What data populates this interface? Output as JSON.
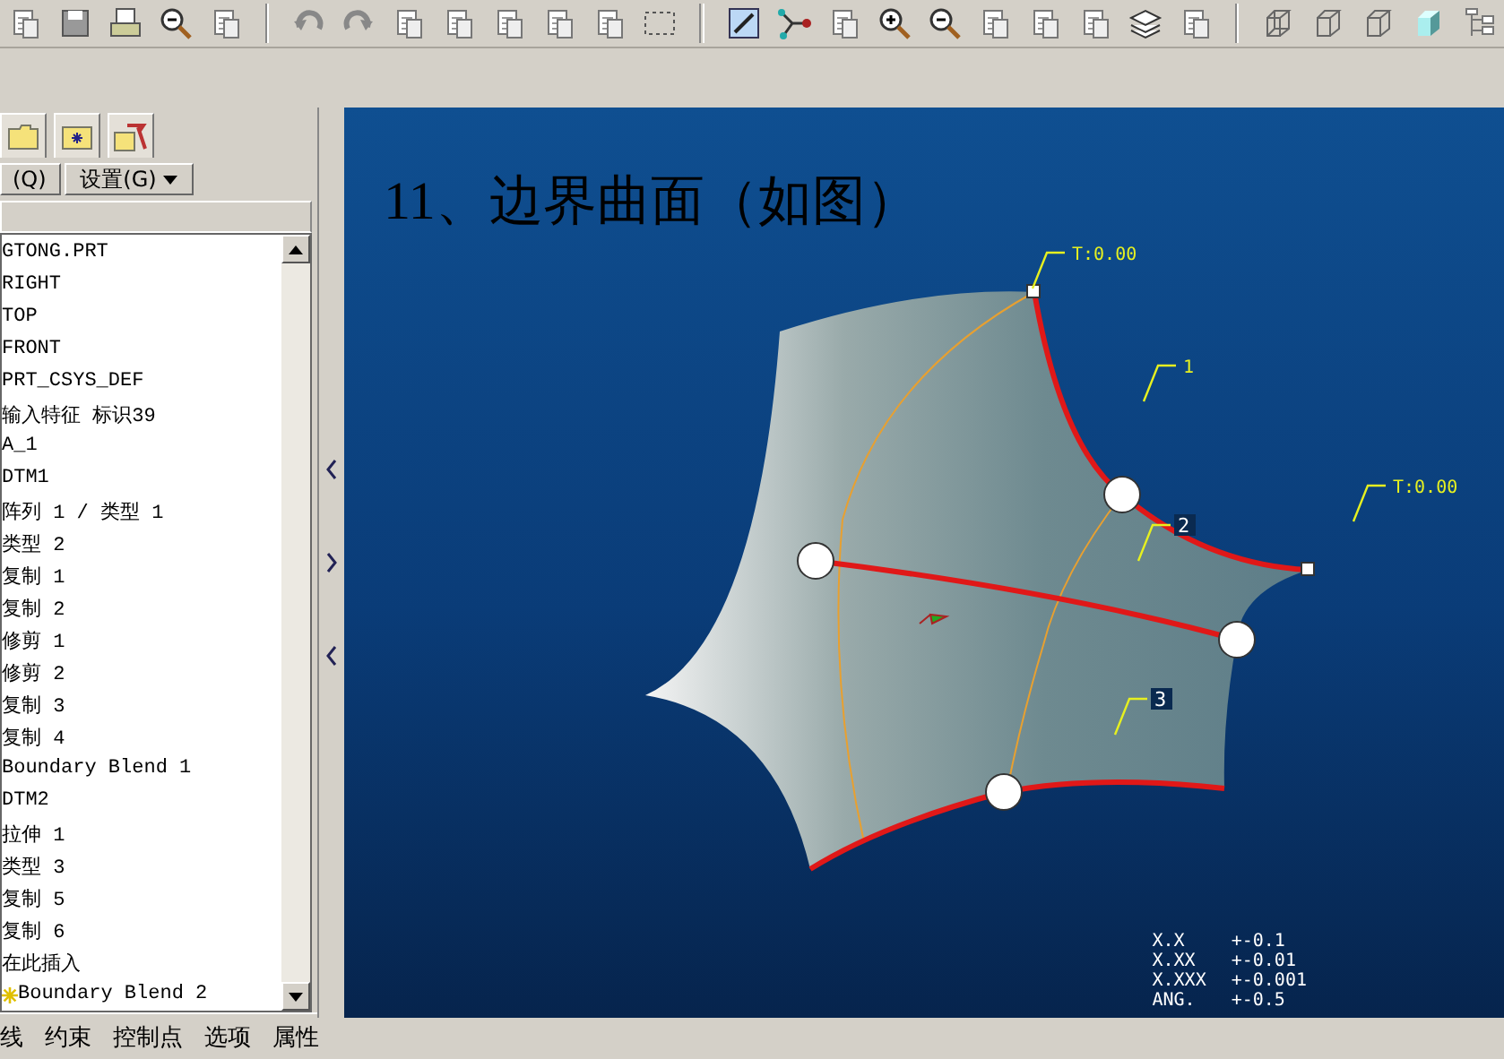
{
  "panel": {
    "buttons": [
      {
        "label": "(Q)"
      },
      {
        "label": "设置(G)"
      }
    ],
    "tree": [
      {
        "label": "GTONG.PRT",
        "kind": "item"
      },
      {
        "label": "RIGHT",
        "kind": "item"
      },
      {
        "label": "TOP",
        "kind": "item"
      },
      {
        "label": "FRONT",
        "kind": "item"
      },
      {
        "label": "PRT_CSYS_DEF",
        "kind": "item"
      },
      {
        "label": "输入特征 标识39",
        "kind": "item"
      },
      {
        "label": "A_1",
        "kind": "item"
      },
      {
        "label": "DTM1",
        "kind": "item"
      },
      {
        "label": "阵列 1 / 类型 1",
        "kind": "item"
      },
      {
        "label": "类型 2",
        "kind": "item"
      },
      {
        "label": "复制 1",
        "kind": "item"
      },
      {
        "label": "复制 2",
        "kind": "item"
      },
      {
        "label": "修剪 1",
        "kind": "item"
      },
      {
        "label": "修剪 2",
        "kind": "item"
      },
      {
        "label": "复制 3",
        "kind": "item"
      },
      {
        "label": "复制 4",
        "kind": "item"
      },
      {
        "label": "Boundary Blend 1",
        "kind": "item"
      },
      {
        "label": "DTM2",
        "kind": "item"
      },
      {
        "label": "拉伸 1",
        "kind": "item"
      },
      {
        "label": "类型 3",
        "kind": "item"
      },
      {
        "label": "复制 5",
        "kind": "item"
      },
      {
        "label": "复制 6",
        "kind": "item"
      },
      {
        "label": "在此插入",
        "kind": "item"
      },
      {
        "label": "Boundary Blend 2",
        "kind": "new"
      }
    ]
  },
  "viewport": {
    "title": "11、边界曲面（如图）",
    "callouts": [
      {
        "label": "T:0.00",
        "kind": "plain"
      },
      {
        "label": "1",
        "kind": "plain"
      },
      {
        "label": "T:0.00",
        "kind": "plain"
      },
      {
        "label": "2",
        "kind": "boxed"
      },
      {
        "label": "3",
        "kind": "boxed"
      }
    ],
    "tolerances": [
      {
        "format": "X.X",
        "value": "+-0.1"
      },
      {
        "format": "X.XX",
        "value": "+-0.01"
      },
      {
        "format": "X.XXX",
        "value": "+-0.001"
      },
      {
        "format": "ANG.",
        "value": "+-0.5"
      }
    ]
  },
  "bottom_tabs": [
    "线",
    "约束",
    "控制点",
    "选项",
    "属性"
  ]
}
